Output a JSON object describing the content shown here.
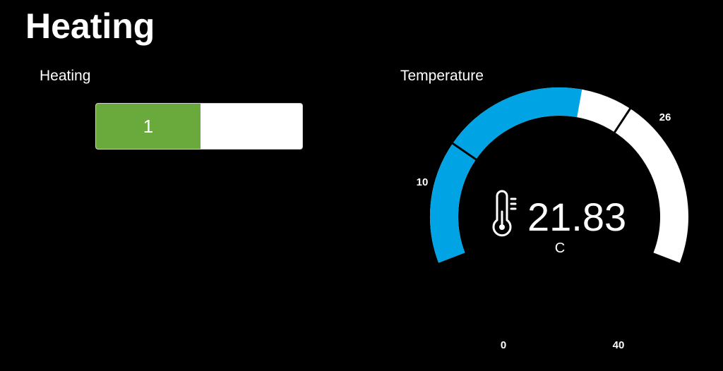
{
  "page": {
    "title": "Heating"
  },
  "heating_switch": {
    "label": "Heating",
    "value": "1",
    "on_color": "#6aaa3c",
    "off_color": "#ffffff"
  },
  "temperature_gauge": {
    "label": "Temperature",
    "value": "21.83",
    "unit": "C",
    "icon": "thermometer-icon",
    "min": 0,
    "max": 40,
    "ticks": [
      "0",
      "10",
      "26",
      "40"
    ],
    "fill_color": "#00a4e4",
    "track_color": "#ffffff"
  }
}
